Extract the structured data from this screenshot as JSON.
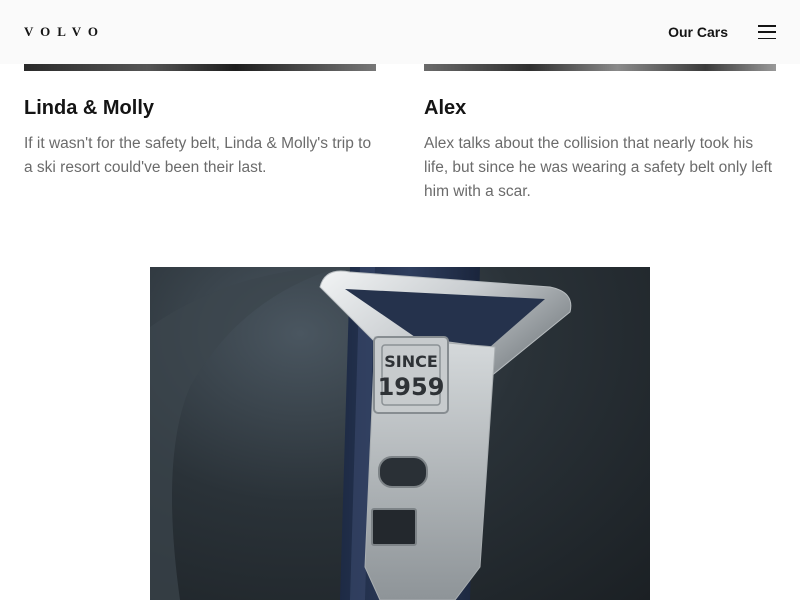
{
  "header": {
    "logo": "VOLVO",
    "nav_link": "Our Cars"
  },
  "stories": [
    {
      "title": "Linda & Molly",
      "text": "If it wasn't for the safety belt, Linda & Molly's trip to a ski resort could've been their last."
    },
    {
      "title": "Alex",
      "text": "Alex talks about the collision that nearly took his life, but since he was wearing a safety belt only left him with a scar."
    }
  ],
  "hero": {
    "stamp_line1": "SINCE",
    "stamp_line2": "1959"
  },
  "icons": {
    "menu": "hamburger-menu-icon"
  }
}
